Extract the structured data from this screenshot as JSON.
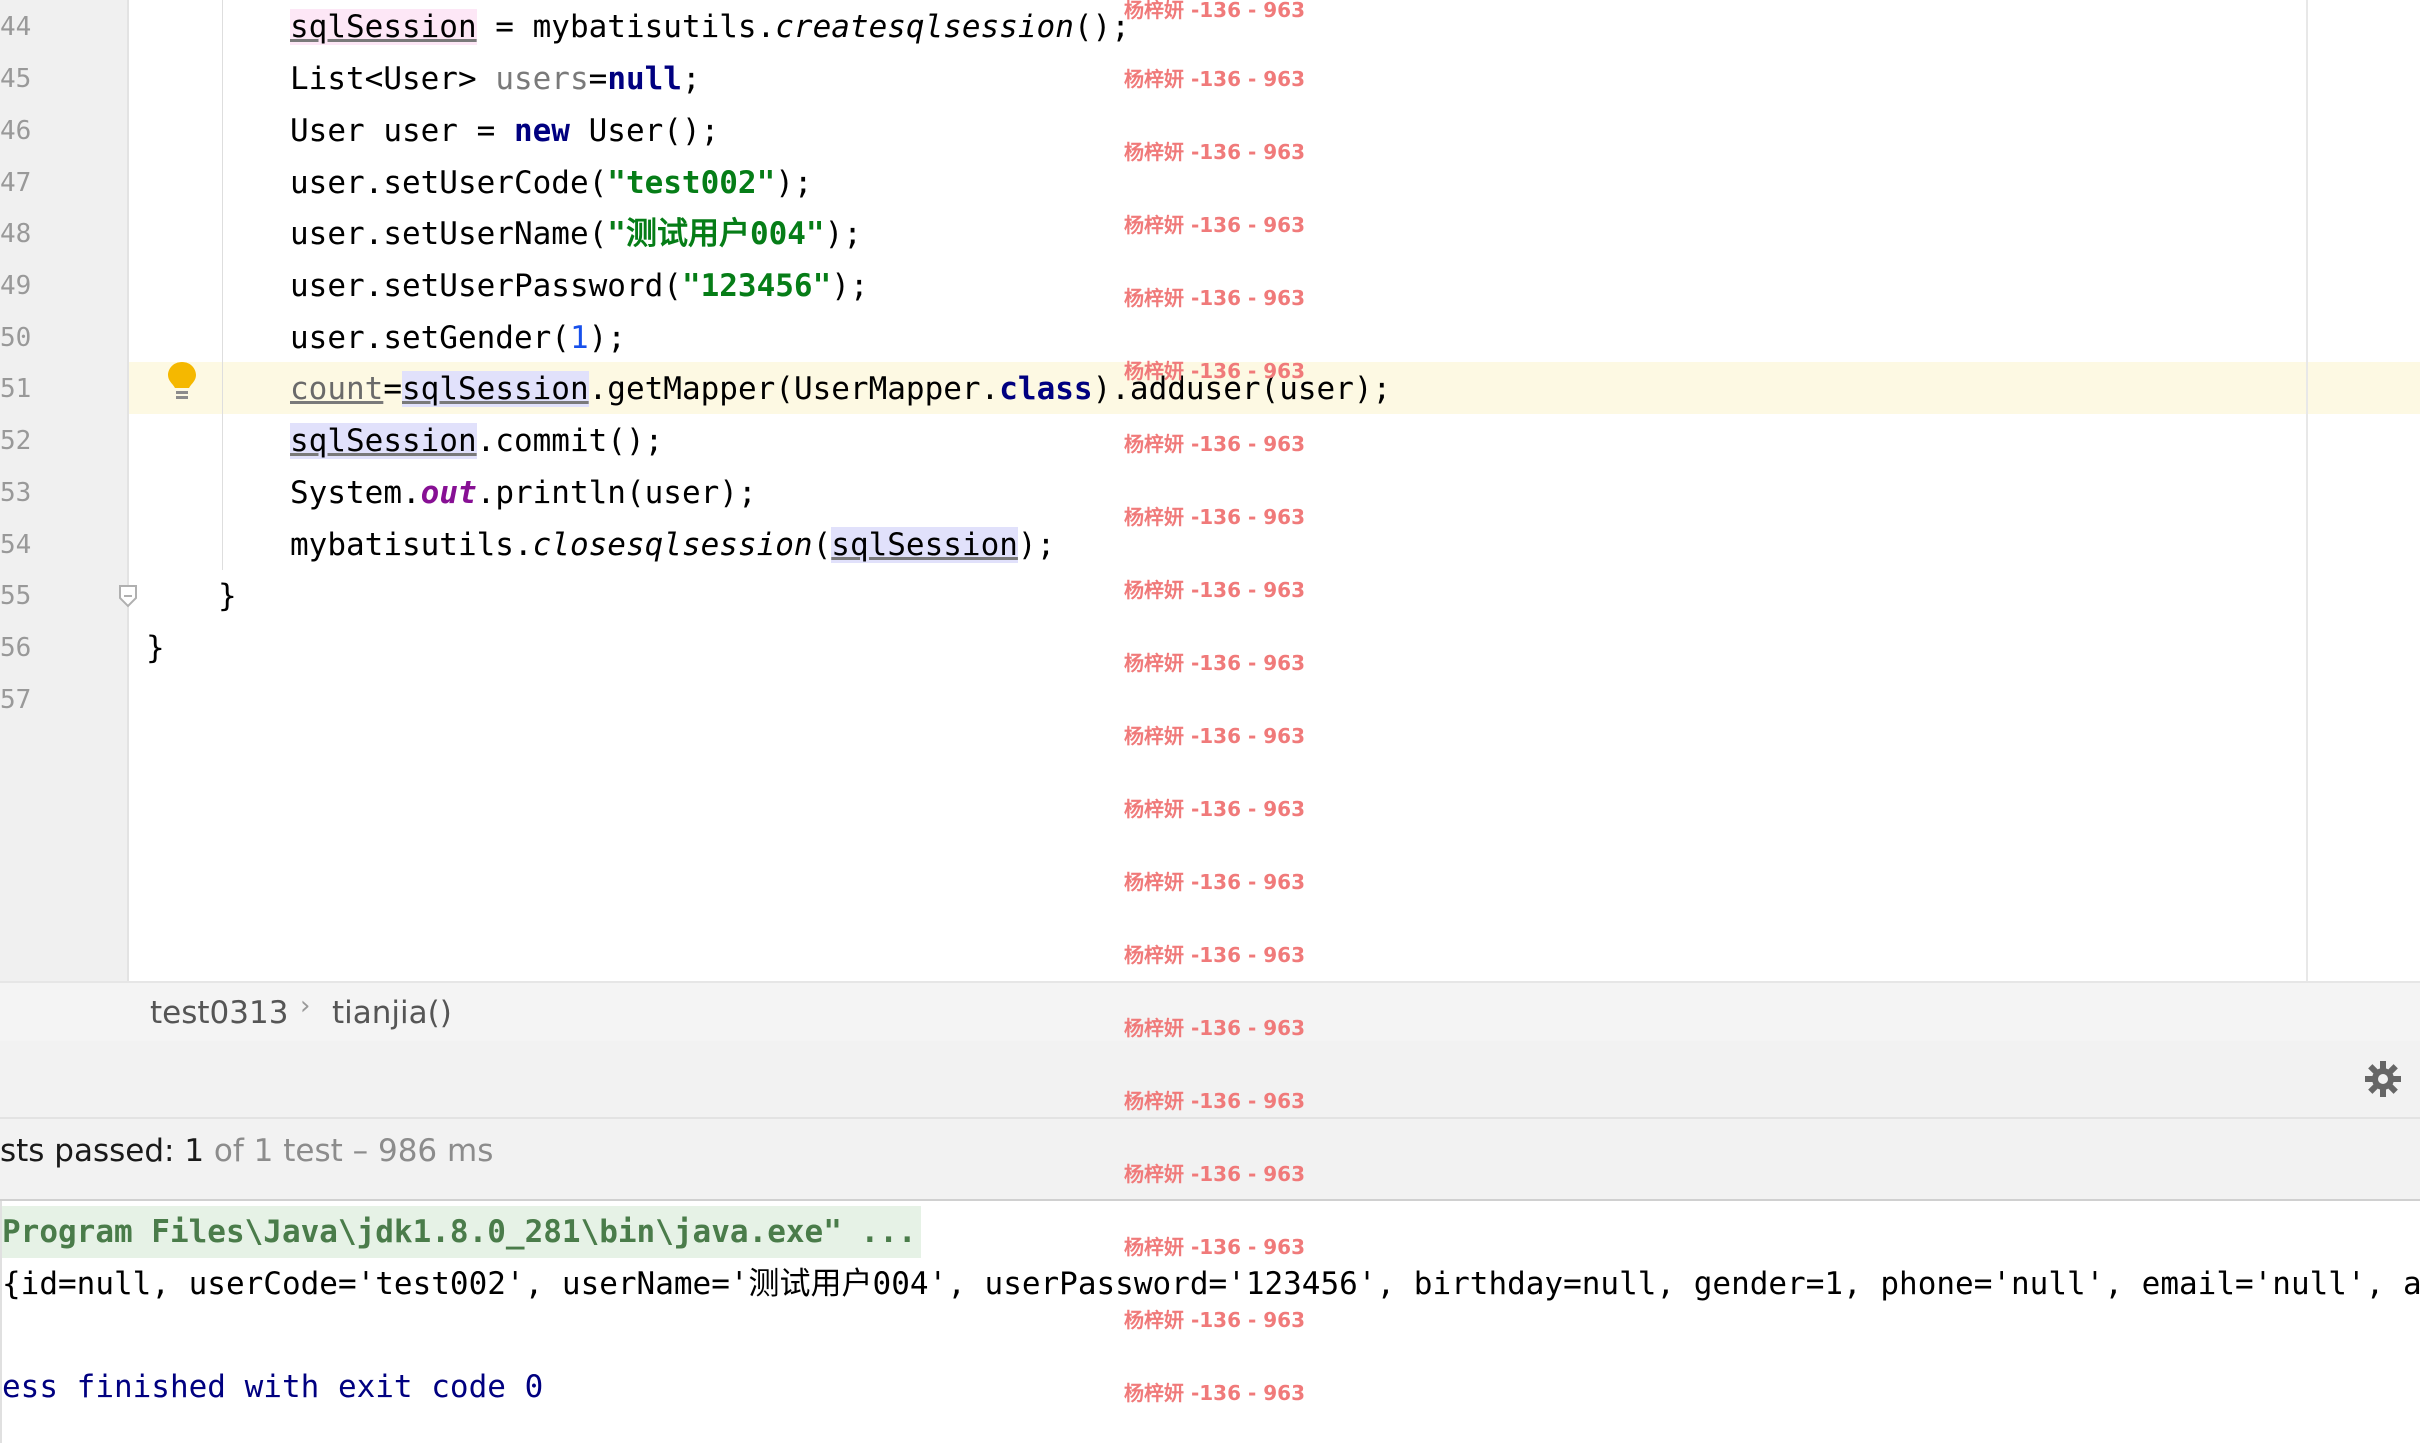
{
  "line_numbers": [
    "44",
    "45",
    "46",
    "47",
    "48",
    "49",
    "50",
    "51",
    "52",
    "53",
    "54",
    "55",
    "56",
    "57"
  ],
  "code": {
    "l44": {
      "var": "sqlSession",
      "rest1": " = mybatisutils.",
      "method": "createsqlsession",
      "rest2": "();"
    },
    "l45": {
      "p1": "List<User> ",
      "var": "users",
      "p2": "=",
      "kw": "null",
      "p3": ";"
    },
    "l46": {
      "p1": "User user = ",
      "kw": "new",
      "p2": " User();"
    },
    "l47": {
      "p1": "user.setUserCode(",
      "str": "\"test002\"",
      "p2": ");"
    },
    "l48": {
      "p1": "user.setUserName(",
      "str": "\"测试用户004\"",
      "p2": ");"
    },
    "l49": {
      "p1": "user.setUserPassword(",
      "str": "\"123456\"",
      "p2": ");"
    },
    "l50": {
      "p1": "user.setGender(",
      "num": "1",
      "p2": ");"
    },
    "l51": {
      "count": "count",
      "eq": "=",
      "var": "sqlSession",
      "p1": ".getMapper(UserMapper.",
      "kw": "class",
      "p2": ").adduser(user);"
    },
    "l52": {
      "var": "sqlSession",
      "p1": ".commit();"
    },
    "l53": {
      "p1": "System.",
      "field": "out",
      "p2": ".println(user);"
    },
    "l54": {
      "p1": "mybatisutils.",
      "method": "closesqlsession",
      "p2": "(",
      "var": "sqlSession",
      "p3": ");"
    },
    "l55": {
      "p1": "}"
    },
    "l56": {
      "p1": "}"
    }
  },
  "breadcrumb": {
    "class": "test0313",
    "method": "tianjia()"
  },
  "status": {
    "prefix": "sts passed: ",
    "count": "1",
    "suffix": " of 1 test – 986 ms"
  },
  "console": {
    "cmd": "Program Files\\Java\\jdk1.8.0_281\\bin\\java.exe\" ...",
    "output": "{id=null, userCode='test002', userName='测试用户004', userPassword='123456', birthday=null, gender=1, phone='null', email='null', addre",
    "exit": "ess finished with exit code 0"
  },
  "watermark": "杨梓妍 -136 - 963",
  "icons": {
    "bulb": "lightbulb-icon",
    "gear": "gear-icon",
    "fold": "fold-marker-icon",
    "separator": "chevron-right-icon"
  },
  "colors": {
    "keyword": "#000080",
    "string": "#067d17",
    "number": "#1750eb",
    "field": "#871094",
    "highlight_line": "#fdf9e3",
    "watermark": "#f07a7a"
  }
}
